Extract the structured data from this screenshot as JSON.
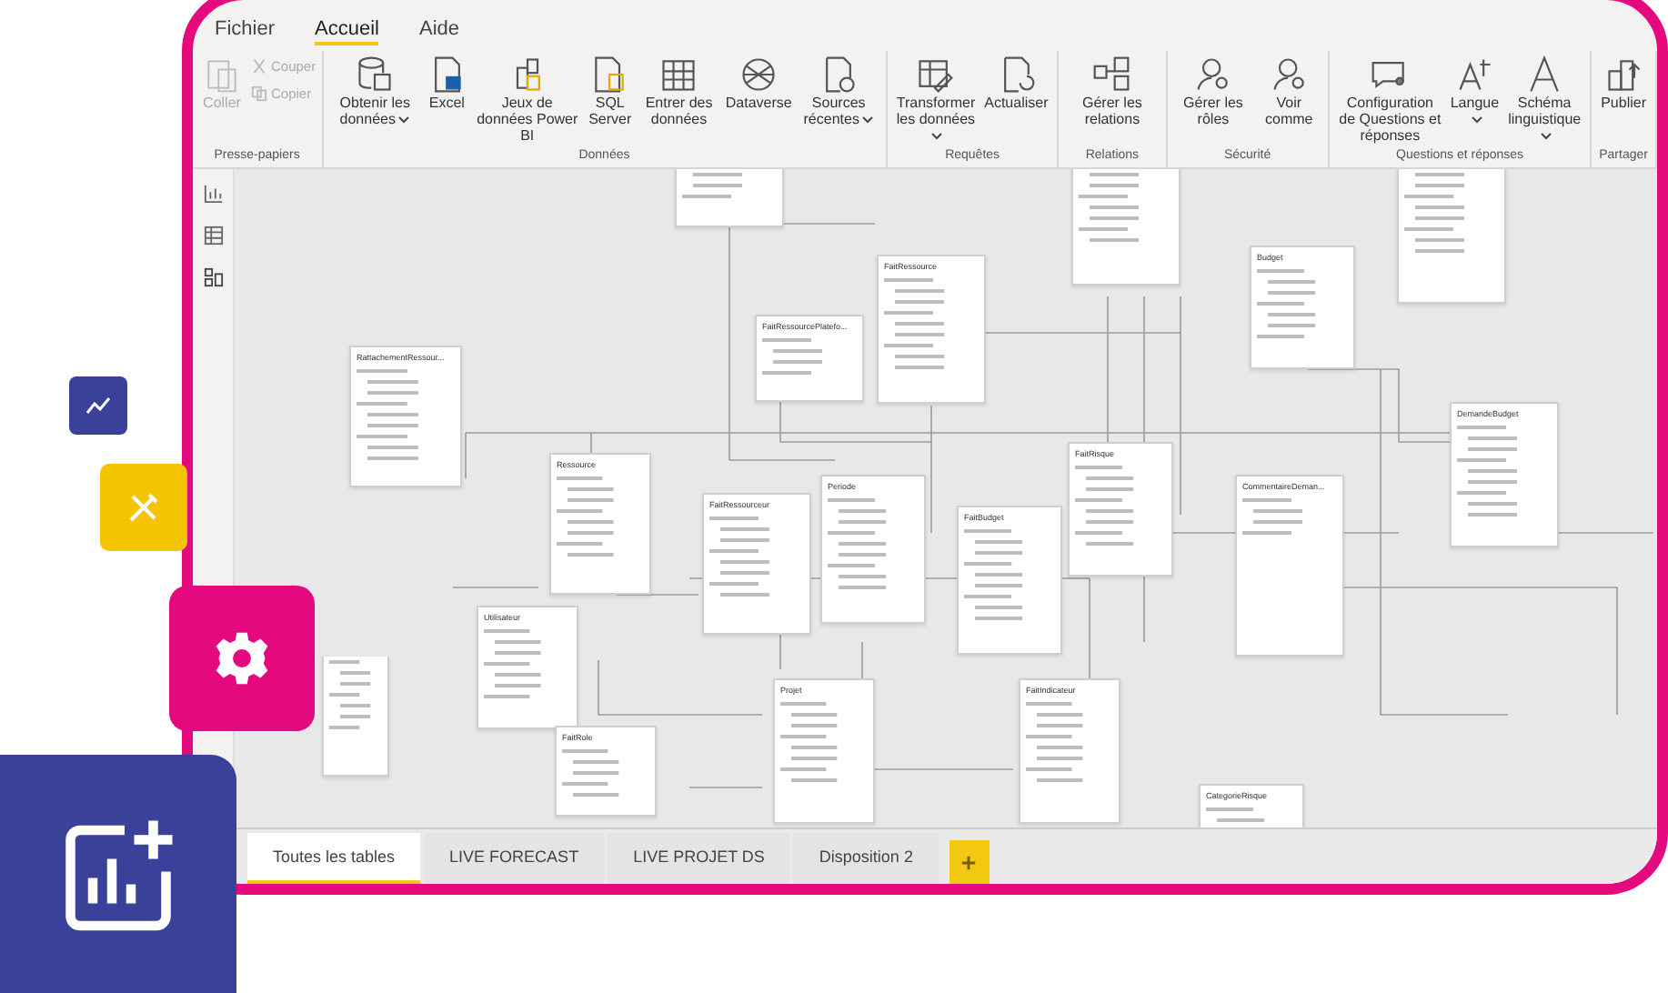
{
  "menu": [
    {
      "label": "Fichier",
      "selected": false
    },
    {
      "label": "Accueil",
      "selected": true
    },
    {
      "label": "Aide",
      "selected": false
    }
  ],
  "ribbon": [
    {
      "label": "Presse-papiers",
      "buttons": [
        {
          "kind": "stack",
          "items": [
            {
              "label": "Coller",
              "disabled": true
            }
          ],
          "small": [
            {
              "label": "Couper",
              "disabled": true
            },
            {
              "label": "Copier",
              "disabled": true
            }
          ]
        }
      ]
    },
    {
      "label": "Données",
      "buttons": [
        {
          "kind": "big",
          "label": "Obtenir les données",
          "caret": true
        },
        {
          "kind": "big",
          "label": "Excel",
          "caret": false
        },
        {
          "kind": "big",
          "label": "Jeux de données Power BI",
          "caret": false
        },
        {
          "kind": "big",
          "label": "SQL Server",
          "caret": false
        },
        {
          "kind": "big",
          "label": "Entrer des données",
          "caret": false
        },
        {
          "kind": "big",
          "label": "Dataverse",
          "caret": false
        },
        {
          "kind": "big",
          "label": "Sources récentes",
          "caret": true
        }
      ]
    },
    {
      "label": "Requêtes",
      "buttons": [
        {
          "kind": "big",
          "label": "Transformer les données",
          "caret": true
        },
        {
          "kind": "big",
          "label": "Actualiser",
          "caret": false
        }
      ]
    },
    {
      "label": "Relations",
      "buttons": [
        {
          "kind": "big",
          "label": "Gérer les relations",
          "caret": false
        }
      ]
    },
    {
      "label": "Sécurité",
      "buttons": [
        {
          "kind": "big",
          "label": "Gérer les rôles",
          "caret": false
        },
        {
          "kind": "big",
          "label": "Voir comme",
          "caret": false
        }
      ]
    },
    {
      "label": "Questions et réponses",
      "buttons": [
        {
          "kind": "big",
          "label": "Configuration de Questions et réponses",
          "caret": false
        },
        {
          "kind": "big",
          "label": "Langue",
          "caret": true
        },
        {
          "kind": "big",
          "label": "Schéma linguistique",
          "caret": true
        }
      ]
    },
    {
      "label": "Partager",
      "buttons": [
        {
          "kind": "big",
          "label": "Publier",
          "caret": false
        }
      ]
    }
  ],
  "tables": [
    {
      "kind": "cut"
    },
    {
      "title": "FaitRessource"
    },
    {
      "title": "FaitRessourcePlatefo..."
    },
    {
      "title": "RattachementRessour..."
    },
    {
      "title": "Ressource"
    },
    {
      "title": "FaitRessourceur"
    },
    {
      "title": "Periode"
    },
    {
      "title": "FaitBudget"
    },
    {
      "title": "FaitRisque"
    },
    {
      "title": "CommentaireDeman..."
    },
    {
      "title": "DemandeBudget"
    },
    {
      "title": "Budget"
    },
    {
      "kind": "cut"
    },
    {
      "kind": "cut"
    },
    {
      "title": "Utilisateur"
    },
    {
      "title": "FaitRole"
    },
    {
      "title": "Projet"
    },
    {
      "title": "FaitIndicateur"
    },
    {
      "title": "CategorieRisque"
    },
    {
      "kind": "cut"
    }
  ],
  "layout_tabs": [
    {
      "label": "Toutes les tables",
      "selected": true
    },
    {
      "label": "LIVE FORECAST",
      "selected": false
    },
    {
      "label": "LIVE PROJET DS",
      "selected": false
    },
    {
      "label": "Disposition 2",
      "selected": false
    }
  ]
}
